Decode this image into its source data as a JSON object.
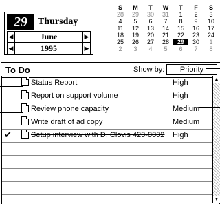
{
  "date": {
    "day_number": "29",
    "weekday": "Thursday",
    "month": "June",
    "year": "1995",
    "arrow_left": "◀",
    "arrow_right": "▶"
  },
  "calendar": {
    "headers": [
      "S",
      "M",
      "T",
      "W",
      "T",
      "F",
      "S"
    ],
    "weeks": [
      [
        "28",
        "29",
        "30",
        "31",
        "1",
        "2",
        "3"
      ],
      [
        "4",
        "5",
        "6",
        "7",
        "8",
        "9",
        "10"
      ],
      [
        "11",
        "12",
        "13",
        "14",
        "15",
        "16",
        "17"
      ],
      [
        "18",
        "19",
        "20",
        "21",
        "22",
        "23",
        "24"
      ],
      [
        "25",
        "26",
        "27",
        "28",
        "29",
        "30",
        "1"
      ],
      [
        "2",
        "3",
        "4",
        "5",
        "6",
        "7",
        "8"
      ]
    ],
    "selected": "29"
  },
  "todo": {
    "title": "To Do",
    "show_by_label": "Show by:",
    "sort_value": "Priority",
    "tasks": [
      {
        "label": "Status Report",
        "priority": "High",
        "done": false
      },
      {
        "label": "Report on support volume",
        "priority": "High",
        "done": false
      },
      {
        "label": "Review phone capacity",
        "priority": "Medium",
        "done": false
      },
      {
        "label": "Write draft of ad copy",
        "priority": "Medium",
        "done": false
      },
      {
        "label": "Setup interview with D. Clovis 423-8882",
        "priority": "High",
        "done": true
      }
    ]
  },
  "icons": {
    "scroll_up": "▲",
    "scroll_down": "▼",
    "check": "✔"
  }
}
